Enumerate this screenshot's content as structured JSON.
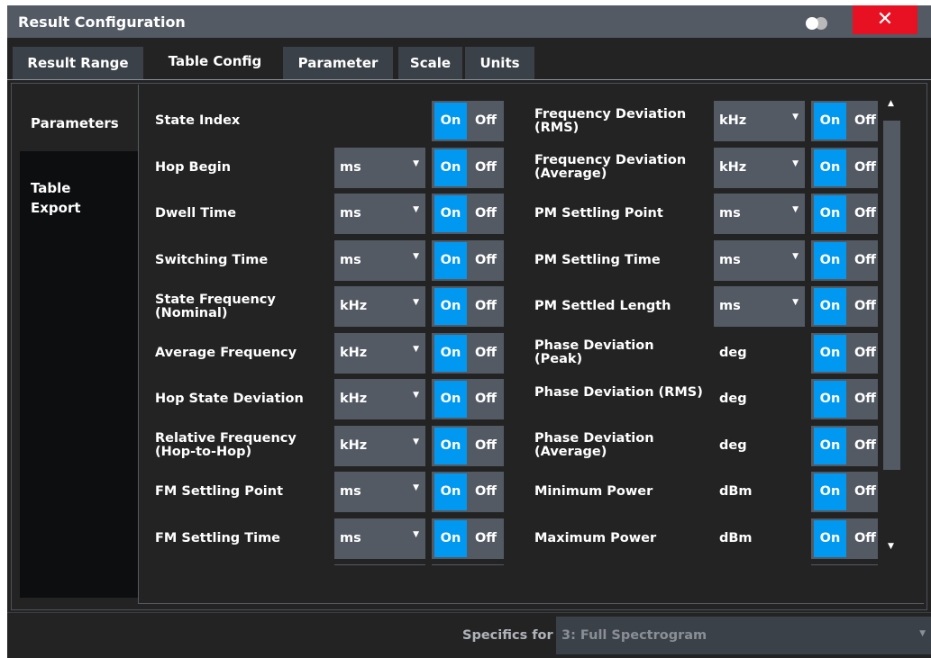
{
  "dialog": {
    "title": "Result Configuration",
    "close_label": "✕"
  },
  "tabs": [
    {
      "label": "Result Range",
      "active": false
    },
    {
      "label": "Table Config",
      "active": true
    },
    {
      "label": "Parameter",
      "active": false
    },
    {
      "label": "Scale",
      "active": false
    },
    {
      "label": "Units",
      "active": false
    }
  ],
  "sidebar": {
    "items": [
      {
        "label": "Parameters",
        "active": true
      },
      {
        "label": "Table Export",
        "active": false
      }
    ]
  },
  "toggle_labels": {
    "on": "On",
    "off": "Off"
  },
  "dropdown_arrow": "▼",
  "left_params": [
    {
      "label": "State Index",
      "unit": null,
      "state": "On"
    },
    {
      "label": "Hop Begin",
      "unit": "ms",
      "state": "On"
    },
    {
      "label": "Dwell Time",
      "unit": "ms",
      "state": "On"
    },
    {
      "label": "Switching Time",
      "unit": "ms",
      "state": "On"
    },
    {
      "label": "State Frequency (Nominal)",
      "unit": "kHz",
      "state": "On"
    },
    {
      "label": "Average Frequency",
      "unit": "kHz",
      "state": "On"
    },
    {
      "label": "Hop State Deviation",
      "unit": "kHz",
      "state": "On"
    },
    {
      "label": "Relative Frequency (Hop-to-Hop)",
      "unit": "kHz",
      "state": "On"
    },
    {
      "label": "FM Settling Point",
      "unit": "ms",
      "state": "On"
    },
    {
      "label": "FM Settling Time",
      "unit": "ms",
      "state": "On"
    }
  ],
  "right_params": [
    {
      "label": "Frequency Deviation (RMS)",
      "unit": "kHz",
      "unit_type": "dropdown",
      "state": "On"
    },
    {
      "label": "Frequency Deviation (Average)",
      "unit": "kHz",
      "unit_type": "dropdown",
      "state": "On"
    },
    {
      "label": "PM Settling Point",
      "unit": "ms",
      "unit_type": "dropdown",
      "state": "On"
    },
    {
      "label": "PM Settling Time",
      "unit": "ms",
      "unit_type": "dropdown",
      "state": "On"
    },
    {
      "label": "PM Settled Length",
      "unit": "ms",
      "unit_type": "dropdown",
      "state": "On"
    },
    {
      "label": "Phase Deviation (Peak)",
      "unit": "deg",
      "unit_type": "static",
      "state": "On"
    },
    {
      "label": "Phase Deviation (RMS)",
      "unit": "deg",
      "unit_type": "static",
      "state": "On"
    },
    {
      "label": "Phase Deviation (Average)",
      "unit": "deg",
      "unit_type": "static",
      "state": "On"
    },
    {
      "label": "Minimum Power",
      "unit": "dBm",
      "unit_type": "static",
      "state": "On"
    },
    {
      "label": "Maximum Power",
      "unit": "dBm",
      "unit_type": "static",
      "state": "On"
    }
  ],
  "scrollbar": {
    "up": "▲",
    "down": "▼"
  },
  "specifics": {
    "label": "Specifics for",
    "value": "3: Full Spectrogram",
    "arrow": "▼"
  },
  "colors": {
    "accent_on": "#0098f0",
    "close_red": "#e81123",
    "titlebar": "#535a64",
    "background": "#232323"
  }
}
